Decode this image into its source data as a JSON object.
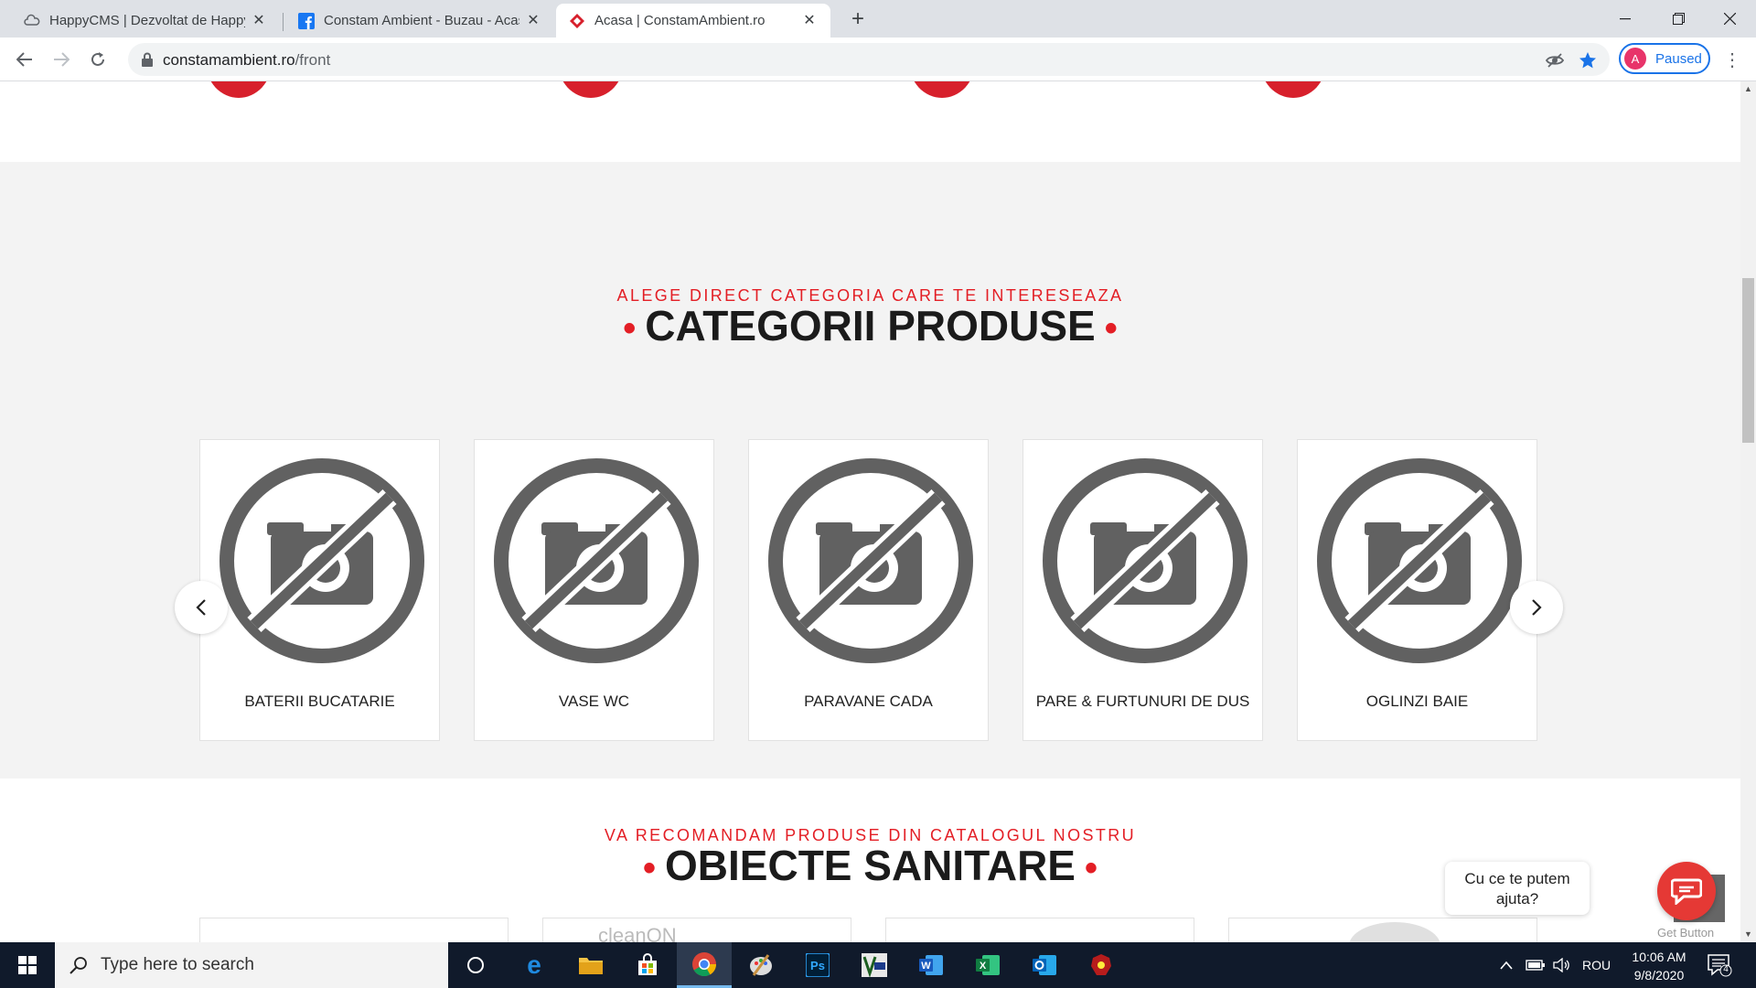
{
  "browser": {
    "tabs": [
      {
        "title": "HappyCMS | Dezvoltat de HappyCMS",
        "favicon": "cloud-icon"
      },
      {
        "title": "Constam Ambient - Buzau - Acasa",
        "favicon": "facebook-icon"
      },
      {
        "title": "Acasa | ConstamAmbient.ro",
        "favicon": "constam-logo-icon"
      }
    ],
    "url_host": "constamambient.ro",
    "url_path": "/front",
    "profile_initial": "A",
    "profile_label": "Paused",
    "accent": "#1a73e8"
  },
  "categories_section": {
    "eyebrow": "ALEGE DIRECT CATEGORIA CARE TE INTERESEAZA",
    "title": "CATEGORII PRODUSE",
    "items": [
      {
        "label": "BATERII BUCATARIE",
        "icon": "no-photo-icon"
      },
      {
        "label": "VASE WC",
        "icon": "no-photo-icon"
      },
      {
        "label": "PARAVANE CADA",
        "icon": "no-photo-icon"
      },
      {
        "label": "PARE & FURTUNURI DE DUS",
        "icon": "no-photo-icon"
      },
      {
        "label": "OGLINZI BAIE",
        "icon": "no-photo-icon"
      }
    ],
    "brand_red": "#e31e25"
  },
  "recommend_section": {
    "eyebrow": "VA RECOMANDAM PRODUSE DIN CATALOGUL NOSTRU",
    "title": "OBIECTE SANITARE",
    "partial_brand_text": "cleanON"
  },
  "chat": {
    "prompt": "Cu ce te putem ajuta?",
    "powered_by": "Get Button"
  },
  "taskbar": {
    "search_placeholder": "Type here to search",
    "language": "ROU",
    "time": "10:06 AM",
    "date": "9/8/2020",
    "notification_count": "4"
  }
}
